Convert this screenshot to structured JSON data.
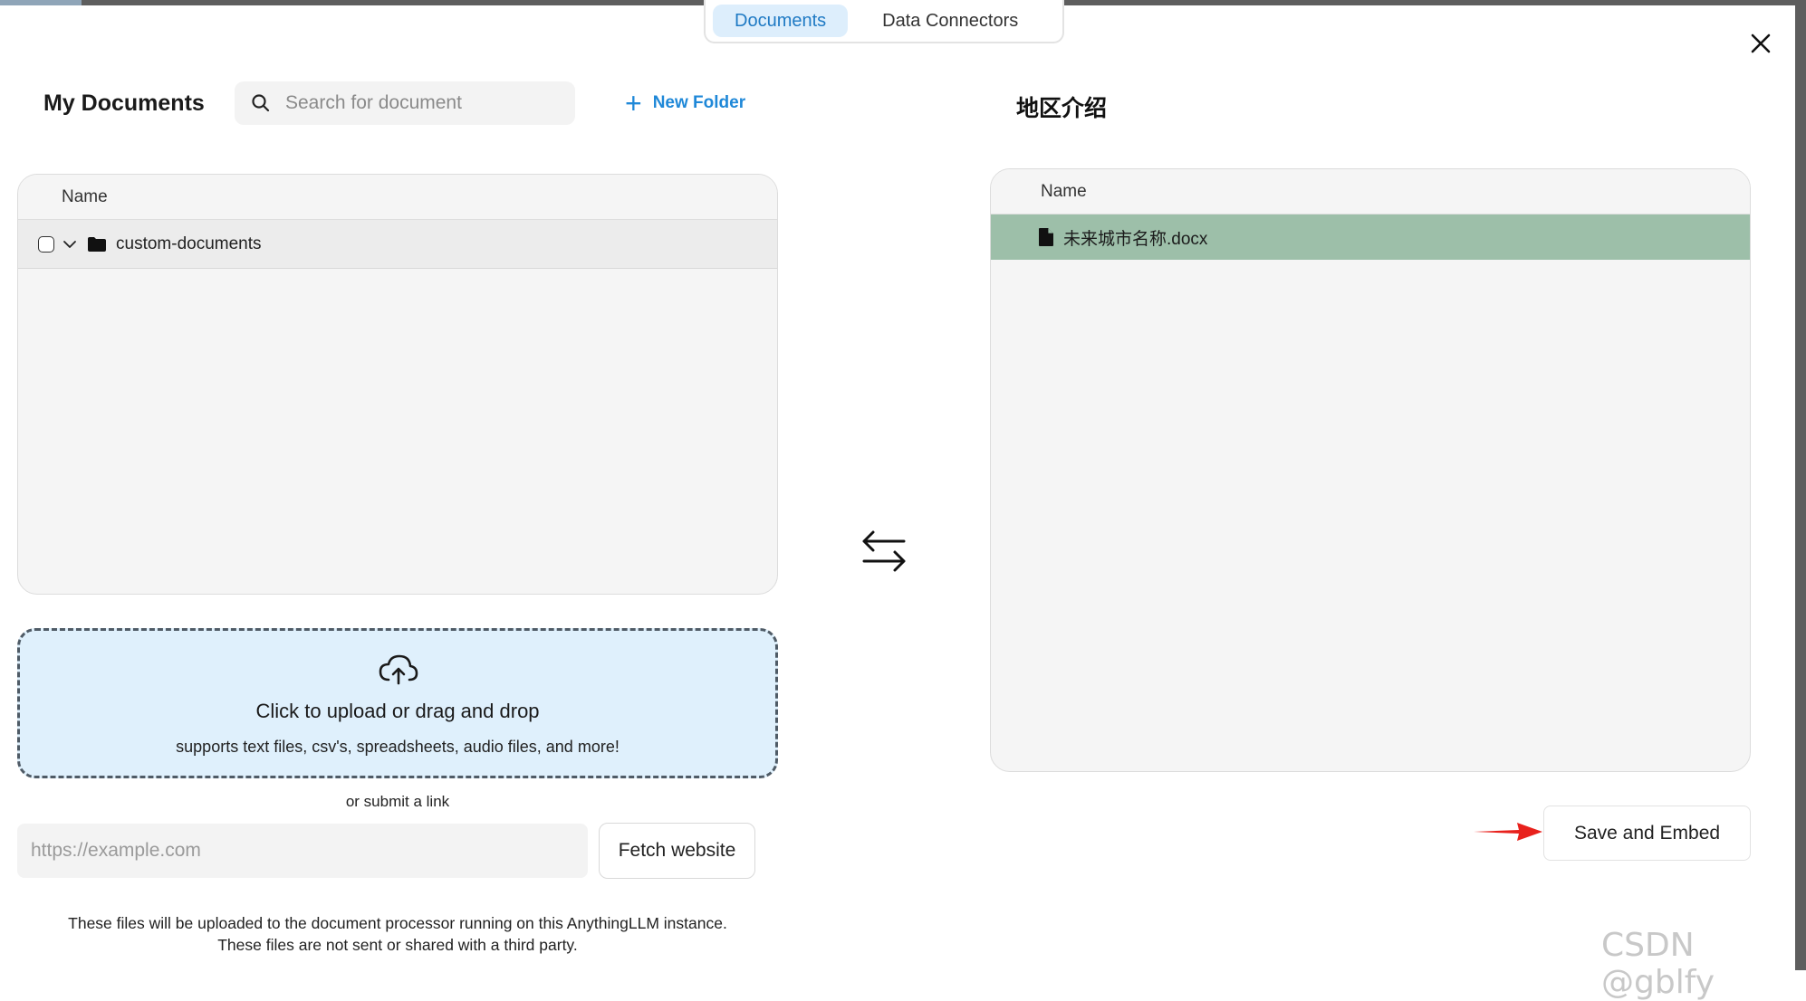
{
  "tabs": [
    {
      "label": "Documents",
      "active": true
    },
    {
      "label": "Data Connectors",
      "active": false
    }
  ],
  "left": {
    "title": "My Documents",
    "search_placeholder": "Search for document",
    "new_folder_label": "New Folder",
    "column_name": "Name",
    "folders": [
      {
        "name": "custom-documents",
        "checked": false
      }
    ]
  },
  "right": {
    "title": "地区介绍",
    "column_name": "Name",
    "files": [
      {
        "name": "未来城市名称.docx"
      }
    ]
  },
  "upload": {
    "title": "Click to upload or drag and drop",
    "subtitle": "supports text files, csv's, spreadsheets, audio files, and more!"
  },
  "link": {
    "or_label": "or submit a link",
    "placeholder": "https://example.com",
    "fetch_label": "Fetch website"
  },
  "note": {
    "line1": "These files will be uploaded to the document processor running on this AnythingLLM instance.",
    "line2": "These files are not sent or shared with a third party."
  },
  "save_label": "Save and Embed",
  "watermark": "CSDN @gblfy",
  "colors": {
    "accent": "#1f88d8",
    "selected_row": "#9dbfa9",
    "upload_bg": "#dff0fc",
    "annotation_arrow": "#e8211c"
  }
}
